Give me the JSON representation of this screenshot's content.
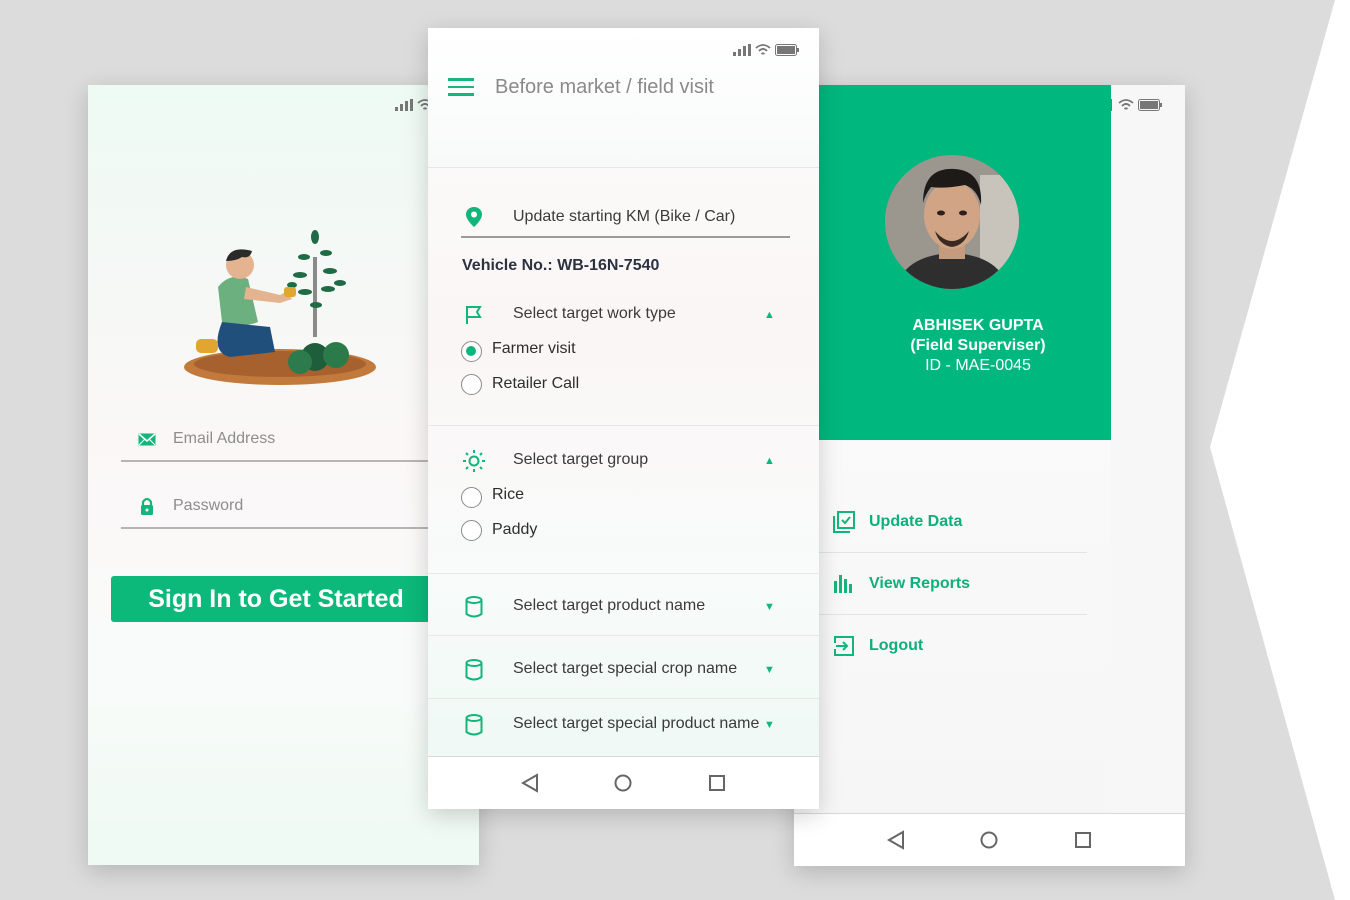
{
  "colors": {
    "accent": "#0cb87a",
    "background": "#dcdcdc",
    "header_green": "#00b77e"
  },
  "login": {
    "email_placeholder": "Email Address",
    "password_placeholder": "Password",
    "signin_label": "Sign In to Get Started",
    "illustration": "farmer-planting-illustration"
  },
  "form": {
    "title": "Before market / field visit",
    "km_label": "Update starting KM (Bike / Car)",
    "vehicle": "Vehicle No.: WB-16N-7540",
    "work_type": {
      "label": "Select target work type",
      "options": [
        {
          "label": "Farmer visit",
          "selected": true
        },
        {
          "label": "Retailer Call",
          "selected": false
        }
      ]
    },
    "target_group": {
      "label": "Select target group",
      "options": [
        {
          "label": "Rice",
          "selected": false
        },
        {
          "label": "Paddy",
          "selected": false
        }
      ]
    },
    "product_name": "Select target product name",
    "special_crop": "Select target special crop name",
    "special_product": "Select target special product name",
    "arrow_up": "▲",
    "arrow_down": "▼"
  },
  "profile": {
    "name": "ABHISEK GUPTA",
    "role": "(Field Superviser)",
    "id": "ID - MAE-0045",
    "menu": [
      {
        "label": "Update Data",
        "icon": "checklist-icon"
      },
      {
        "label": "View Reports",
        "icon": "bar-chart-icon"
      },
      {
        "label": "Logout",
        "icon": "logout-icon"
      }
    ]
  }
}
